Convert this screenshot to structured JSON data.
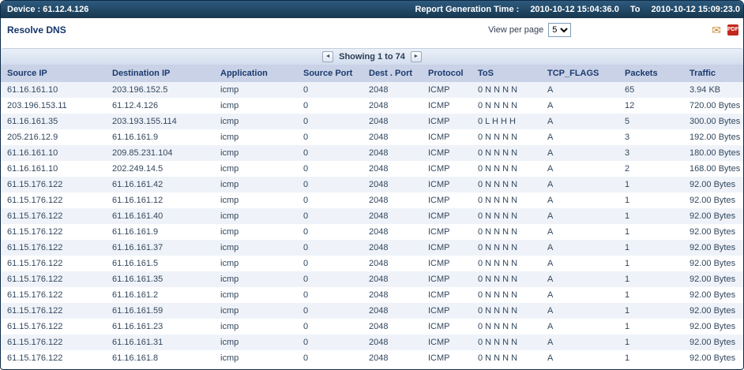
{
  "header": {
    "device_label": "Device : 61.12.4.126",
    "report_time_label": "Report Generation Time :",
    "report_time_from": "2010-10-12 15:04:36.0",
    "report_time_to_label": "To",
    "report_time_to": "2010-10-12 15:09:23.0"
  },
  "toolbar": {
    "title": "Resolve DNS",
    "view_per_page_label": "View per page",
    "view_per_page_value": "5",
    "pdf_glyph": "PDF",
    "mail_glyph": "✉"
  },
  "pagination": {
    "prev_icon": "◄",
    "showing_text": "Showing 1 to 74",
    "next_icon": "►"
  },
  "table": {
    "columns": [
      "Source IP",
      "Destination IP",
      "Application",
      "Source Port",
      "Dest . Port",
      "Protocol",
      "ToS",
      "TCP_FLAGS",
      "Packets",
      "Traffic"
    ],
    "rows": [
      [
        "61.16.161.10",
        "203.196.152.5",
        "icmp",
        "0",
        "2048",
        "ICMP",
        "0 N N N N",
        "A",
        "65",
        "3.94 KB"
      ],
      [
        "203.196.153.11",
        "61.12.4.126",
        "icmp",
        "0",
        "2048",
        "ICMP",
        "0 N N N N",
        "A",
        "12",
        "720.00 Bytes"
      ],
      [
        "61.16.161.35",
        "203.193.155.114",
        "icmp",
        "0",
        "2048",
        "ICMP",
        "0 L H H H",
        "A",
        "5",
        "300.00 Bytes"
      ],
      [
        "205.216.12.9",
        "61.16.161.9",
        "icmp",
        "0",
        "2048",
        "ICMP",
        "0 N N N N",
        "A",
        "3",
        "192.00 Bytes"
      ],
      [
        "61.16.161.10",
        "209.85.231.104",
        "icmp",
        "0",
        "2048",
        "ICMP",
        "0 N N N N",
        "A",
        "3",
        "180.00 Bytes"
      ],
      [
        "61.16.161.10",
        "202.249.14.5",
        "icmp",
        "0",
        "2048",
        "ICMP",
        "0 N N N N",
        "A",
        "2",
        "168.00 Bytes"
      ],
      [
        "61.15.176.122",
        "61.16.161.42",
        "icmp",
        "0",
        "2048",
        "ICMP",
        "0 N N N N",
        "A",
        "1",
        "92.00 Bytes"
      ],
      [
        "61.15.176.122",
        "61.16.161.12",
        "icmp",
        "0",
        "2048",
        "ICMP",
        "0 N N N N",
        "A",
        "1",
        "92.00 Bytes"
      ],
      [
        "61.15.176.122",
        "61.16.161.40",
        "icmp",
        "0",
        "2048",
        "ICMP",
        "0 N N N N",
        "A",
        "1",
        "92.00 Bytes"
      ],
      [
        "61.15.176.122",
        "61.16.161.9",
        "icmp",
        "0",
        "2048",
        "ICMP",
        "0 N N N N",
        "A",
        "1",
        "92.00 Bytes"
      ],
      [
        "61.15.176.122",
        "61.16.161.37",
        "icmp",
        "0",
        "2048",
        "ICMP",
        "0 N N N N",
        "A",
        "1",
        "92.00 Bytes"
      ],
      [
        "61.15.176.122",
        "61.16.161.5",
        "icmp",
        "0",
        "2048",
        "ICMP",
        "0 N N N N",
        "A",
        "1",
        "92.00 Bytes"
      ],
      [
        "61.15.176.122",
        "61.16.161.35",
        "icmp",
        "0",
        "2048",
        "ICMP",
        "0 N N N N",
        "A",
        "1",
        "92.00 Bytes"
      ],
      [
        "61.15.176.122",
        "61.16.161.2",
        "icmp",
        "0",
        "2048",
        "ICMP",
        "0 N N N N",
        "A",
        "1",
        "92.00 Bytes"
      ],
      [
        "61.15.176.122",
        "61.16.161.59",
        "icmp",
        "0",
        "2048",
        "ICMP",
        "0 N N N N",
        "A",
        "1",
        "92.00 Bytes"
      ],
      [
        "61.15.176.122",
        "61.16.161.23",
        "icmp",
        "0",
        "2048",
        "ICMP",
        "0 N N N N",
        "A",
        "1",
        "92.00 Bytes"
      ],
      [
        "61.15.176.122",
        "61.16.161.31",
        "icmp",
        "0",
        "2048",
        "ICMP",
        "0 N N N N",
        "A",
        "1",
        "92.00 Bytes"
      ],
      [
        "61.15.176.122",
        "61.16.161.8",
        "icmp",
        "0",
        "2048",
        "ICMP",
        "0 N N N N",
        "A",
        "1",
        "92.00 Bytes"
      ]
    ]
  }
}
